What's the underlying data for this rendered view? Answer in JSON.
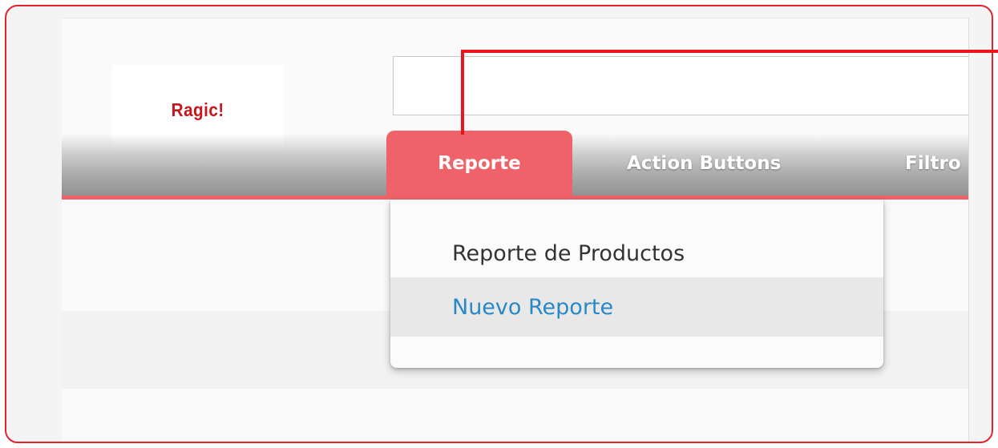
{
  "logo": {
    "text": "Ragic!"
  },
  "search": {
    "value": "",
    "placeholder": ""
  },
  "nav": {
    "tabs": [
      {
        "label": "Reporte",
        "active": true
      },
      {
        "label": "Action Buttons",
        "active": false
      },
      {
        "label": "Filtro",
        "active": false
      }
    ]
  },
  "dropdown": {
    "items": [
      {
        "label": "Reporte de Productos"
      },
      {
        "label": "Nuevo Reporte"
      }
    ]
  },
  "colors": {
    "accent": "#f0626a",
    "highlight_border": "#e4222e",
    "link": "#2a88c6",
    "logo": "#c8161d"
  }
}
